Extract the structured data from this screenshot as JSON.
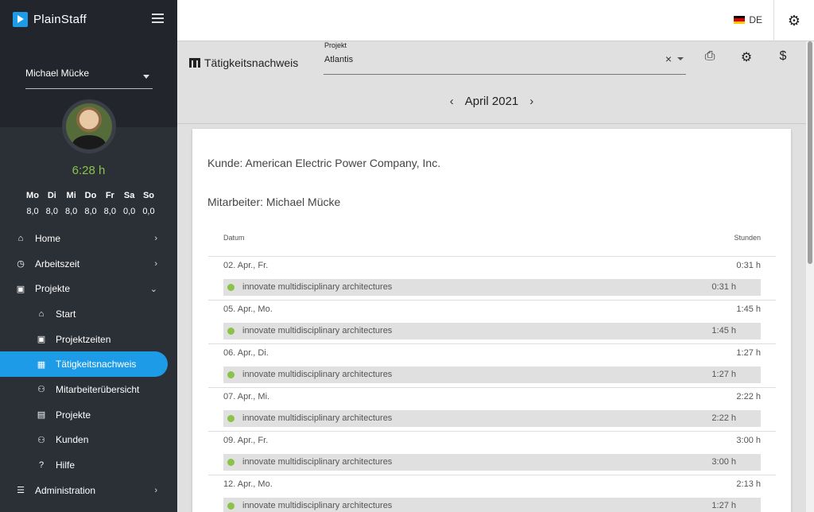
{
  "app": {
    "name": "PlainStaff"
  },
  "sidebar": {
    "user": "Michael Mücke",
    "time_total": "6:28 h",
    "week": {
      "days": [
        "Mo",
        "Di",
        "Mi",
        "Do",
        "Fr",
        "Sa",
        "So"
      ],
      "hours": [
        "8,0",
        "8,0",
        "8,0",
        "8,0",
        "8,0",
        "0,0",
        "0,0"
      ]
    },
    "nav": [
      {
        "label": "Home",
        "icon": "home-icon"
      },
      {
        "label": "Arbeitszeit",
        "icon": "clock-icon"
      },
      {
        "label": "Projekte",
        "icon": "clipboard-icon"
      },
      {
        "label": "Start",
        "icon": "home-icon"
      },
      {
        "label": "Projektzeiten",
        "icon": "clipboard-icon"
      },
      {
        "label": "Tätigkeitsnachweis",
        "icon": "table-icon"
      },
      {
        "label": "Mitarbeiterübersicht",
        "icon": "people-icon"
      },
      {
        "label": "Projekte",
        "icon": "briefcase-icon"
      },
      {
        "label": "Kunden",
        "icon": "people-icon"
      },
      {
        "label": "Hilfe",
        "icon": "help-icon"
      },
      {
        "label": "Administration",
        "icon": "sliders-icon"
      }
    ]
  },
  "topbar": {
    "language": "DE"
  },
  "header": {
    "title": "Tätigkeitsnachweis",
    "project_label": "Projekt",
    "project_value": "Atlantis",
    "month": "April 2021"
  },
  "report": {
    "kunde": "Kunde: American Electric Power Company, Inc.",
    "mitarbeiter": "Mitarbeiter: Michael Mücke",
    "col_datum": "Datum",
    "col_stunden": "Stunden",
    "days": [
      {
        "date": "02. Apr., Fr.",
        "total": "0:31 h",
        "entry": "innovate multidisciplinary architectures",
        "hours": "0:31 h"
      },
      {
        "date": "05. Apr., Mo.",
        "total": "1:45 h",
        "entry": "innovate multidisciplinary architectures",
        "hours": "1:45 h"
      },
      {
        "date": "06. Apr., Di.",
        "total": "1:27 h",
        "entry": "innovate multidisciplinary architectures",
        "hours": "1:27 h"
      },
      {
        "date": "07. Apr., Mi.",
        "total": "2:22 h",
        "entry": "innovate multidisciplinary architectures",
        "hours": "2:22 h"
      },
      {
        "date": "09. Apr., Fr.",
        "total": "3:00 h",
        "entry": "innovate multidisciplinary architectures",
        "hours": "3:00 h"
      },
      {
        "date": "12. Apr., Mo.",
        "total": "2:13 h",
        "entry": "innovate multidisciplinary architectures",
        "hours": "1:27 h"
      }
    ]
  },
  "colors": {
    "accent": "#1e9be6",
    "green": "#8bc34a",
    "sidebar": "#2b2f36"
  }
}
